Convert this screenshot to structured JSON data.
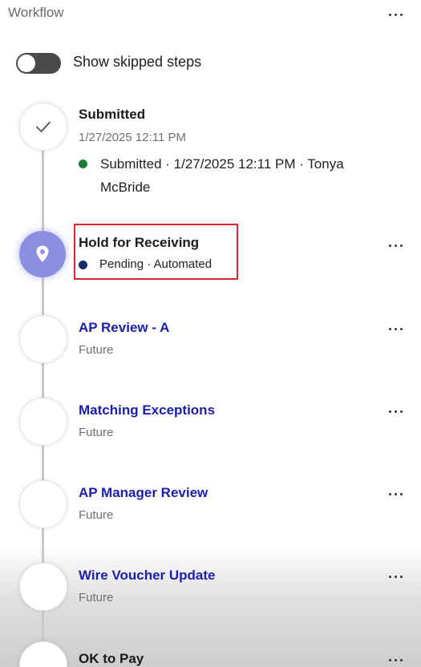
{
  "header": {
    "title": "Workflow"
  },
  "toggle": {
    "label": "Show skipped steps",
    "state": "off"
  },
  "steps": [
    {
      "title": "Submitted",
      "date": "1/27/2025 12:11 PM",
      "status_dot_color": "#1f7a3a",
      "status_text": "Submitted · 1/27/2025 12:11 PM · Tonya McBride",
      "icon": "check-icon"
    },
    {
      "title": "Hold for Receiving",
      "status_dot_color": "#1a2a6b",
      "status_text": "Pending · Automated",
      "icon": "location-pin-icon"
    },
    {
      "title": "AP Review - A",
      "sub": "Future"
    },
    {
      "title": "Matching Exceptions",
      "sub": "Future"
    },
    {
      "title": "AP Manager Review",
      "sub": "Future"
    },
    {
      "title": "Wire Voucher Update",
      "sub": "Future"
    },
    {
      "title": "OK to Pay"
    }
  ],
  "colors": {
    "link": "#1a1fb0",
    "active_node": "#8a8fe0",
    "highlight": "#e0242c"
  }
}
